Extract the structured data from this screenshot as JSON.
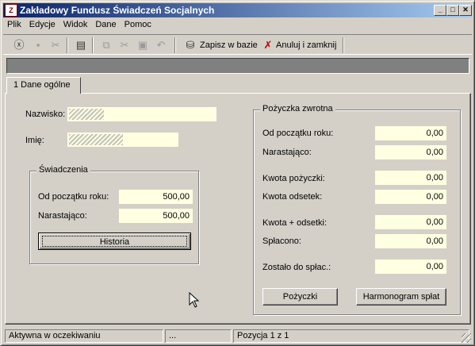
{
  "window": {
    "title": "Zakładowy Fundusz Świadczeń Socjalnych",
    "icon": "app-icon",
    "controls": [
      "minimize",
      "maximize",
      "close"
    ]
  },
  "menu": [
    "Plik",
    "Edycje",
    "Widok",
    "Dane",
    "Pomoc"
  ],
  "toolbar": {
    "save_label": "Zapisz w bazie",
    "cancel_close_label": "Anuluj i zamknij"
  },
  "tabs": [
    {
      "label": "1 Dane ogólne"
    }
  ],
  "form": {
    "nazwisko_label": "Nazwisko:",
    "imie_label": "Imię:",
    "swiadczenia": {
      "title": "Świadczenia",
      "od_poczatku_label": "Od początku roku:",
      "od_poczatku_value": "500,00",
      "narastajaco_label": "Narastająco:",
      "narastajaco_value": "500,00",
      "historia_button": "Historia"
    },
    "pozyczka": {
      "title": "Pożyczka zwrotna",
      "od_poczatku_label": "Od początku roku:",
      "od_poczatku_value": "0,00",
      "narastajaco_label": "Narastająco:",
      "narastajaco_value": "0,00",
      "kwota_pozyczki_label": "Kwota pożyczki:",
      "kwota_pozyczki_value": "0,00",
      "kwota_odsetek_label": "Kwota odsetek:",
      "kwota_odsetek_value": "0,00",
      "kwota_plus_odsetki_label": "Kwota + odsetki:",
      "kwota_plus_odsetki_value": "0,00",
      "splacono_label": "Spłacono:",
      "splacono_value": "0,00",
      "zostalo_label": "Zostało do spłac.:",
      "zostalo_value": "0,00",
      "pozyczki_button": "Pożyczki",
      "harmonogram_button": "Harmonogram spłat"
    }
  },
  "status": {
    "state": "Aktywna w oczekiwaniu",
    "middle": "...",
    "position": "Pozycja 1 z 1"
  },
  "colors": {
    "title_gradient_start": "#0a246a",
    "title_gradient_end": "#a6caf0",
    "field_bg": "#ffffe1",
    "face": "#d4d0c8"
  }
}
